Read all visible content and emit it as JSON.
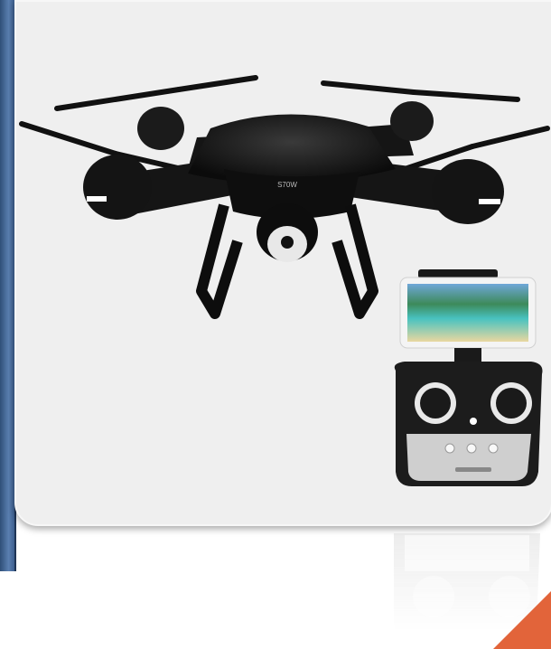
{
  "slide": {
    "accent_color": "#e2643a",
    "sidebar_color": "#3d5f8f",
    "image": {
      "subject": "drone-with-remote-controller",
      "icon": "drone-icon"
    }
  }
}
